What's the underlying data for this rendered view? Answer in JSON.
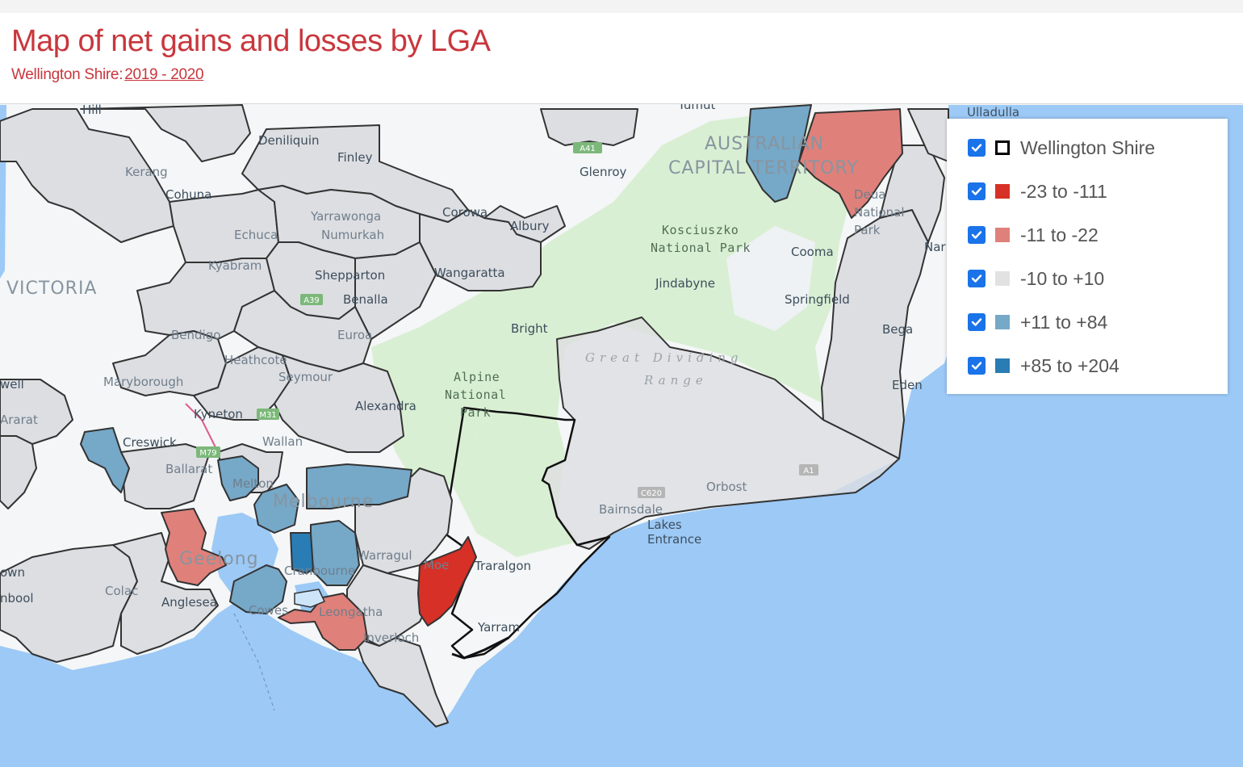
{
  "header": {
    "title": "Map of net gains and losses by LGA",
    "subtitle_area": "Wellington Shire:",
    "subtitle_period": "2019 - 2020"
  },
  "legend": {
    "items": [
      {
        "label": "Wellington Shire",
        "checked": true,
        "color": "#ffffff",
        "border": "#000000",
        "icon": "outline-square-icon"
      },
      {
        "label": "-23 to -111",
        "checked": true,
        "color": "#d73027",
        "icon": "dark-red-swatch-icon"
      },
      {
        "label": "-11 to -22",
        "checked": true,
        "color": "#e0807a",
        "icon": "light-red-swatch-icon"
      },
      {
        "label": "-10 to +10",
        "checked": true,
        "color": "#e2e2e2",
        "icon": "grey-swatch-icon"
      },
      {
        "label": "+11 to +84",
        "checked": true,
        "color": "#76a8c8",
        "icon": "light-blue-swatch-icon"
      },
      {
        "label": "+85 to +204",
        "checked": true,
        "color": "#2a7cb4",
        "icon": "dark-blue-swatch-icon"
      }
    ]
  },
  "map": {
    "colors": {
      "land": "#f4f6f7",
      "water": "#9cc9f6",
      "park": "#d9efd3",
      "lga_neutral": "#dddee2",
      "lga_light_red": "#e0807a",
      "lga_dark_red": "#d73027",
      "lga_light_blue": "#76a8c8",
      "lga_dark_blue": "#2a7cb4"
    },
    "places": {
      "hill": "Hill",
      "deniliquin": "Deniliquin",
      "finley": "Finley",
      "tumut": "Tumut",
      "ulladulla": "Ulladulla",
      "act": "AUSTRALIAN",
      "act2": "CAPITAL TERRITORY",
      "kerang": "Kerang",
      "cohuna": "Cohuna",
      "glenroy": "Glenroy",
      "yarrawonga": "Yarrawonga",
      "corowa": "Corowa",
      "numurkah": "Numurkah",
      "echuca": "Echuca",
      "albury": "Albury",
      "kosciuszko": "Kosciuszko",
      "kosciuszko2": "National Park",
      "cooma": "Cooma",
      "deua": "Deua",
      "deua2": "National",
      "deua3": "Park",
      "narooma": "Nar",
      "kyabram": "Kyabram",
      "victoria": "VICTORIA",
      "shepparton": "Shepparton",
      "wangaratta": "Wangaratta",
      "jindabyne": "Jindabyne",
      "springfield": "Springfield",
      "benalla": "Benalla",
      "bright": "Bright",
      "bega": "Bega",
      "bendigo": "Bendigo",
      "euroa": "Euroa",
      "great_dividing": "Great Dividing",
      "range": "Range",
      "heathcote": "Heathcote",
      "eden": "Eden",
      "stawell": "well",
      "maryborough": "Maryborough",
      "seymour": "Seymour",
      "alpine": "Alpine",
      "alpine2": "National",
      "alpine3": "Park",
      "ararat": "Ararat",
      "alexandra": "Alexandra",
      "kyneton": "Kyneton",
      "creswick": "Creswick",
      "wallan": "Wallan",
      "ballarat": "Ballarat",
      "orbost": "Orbost",
      "melton": "Melton",
      "melbourne": "Melbourne",
      "bairnsdale": "Bairnsdale",
      "lakes": "Lakes",
      "entrance": "Entrance",
      "geelong": "Geelong",
      "warragul": "Warragul",
      "moe": "Moe",
      "traralgon": "Traralgon",
      "cranbourne": "Cranbourne",
      "camperdown": "own",
      "warrnambool": "nbool",
      "colac": "Colac",
      "anglesea": "Anglesea",
      "cowes": "Cowes",
      "leongatha": "Leongatha",
      "yarram": "Yarram",
      "inverloch": "Inverloch"
    },
    "shields": {
      "a39": "A39",
      "m31": "M31",
      "m79": "M79",
      "a1": "A1",
      "c620": "C620",
      "a41": "A41"
    }
  }
}
